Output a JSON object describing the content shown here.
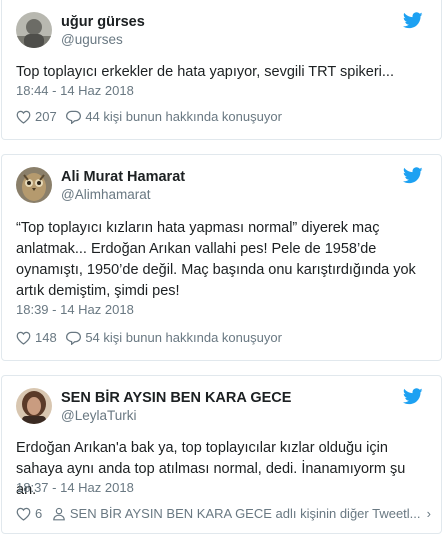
{
  "colors": {
    "twitter_blue": "#1da1f2",
    "meta_gray": "#697882",
    "text": "#1c2022",
    "border": "#e1e8ed"
  },
  "tweets": [
    {
      "display_name": "uğur gürses",
      "screen_name": "@ugurses",
      "avatar_icon": "avatar-photo-gray",
      "text": "Top toplayıcı erkekler de hata yapıyor, sevgili TRT spikeri...",
      "timestamp": "18:44 - 14 Haz 2018",
      "likes": "207",
      "replies_label": "44 kişi bunun hakkında konuşuyor",
      "replies_icon": "speech-bubble-icon"
    },
    {
      "display_name": "Ali Murat Hamarat",
      "screen_name": "@Alimhamarat",
      "avatar_icon": "avatar-photo-owl",
      "text": "“Top toplayıcı kızların hata yapması normal” diyerek maç anlatmak... Erdoğan Arıkan vallahi pes! Pele de 1958’de oynamıştı, 1950’de değil. Maç başında onu karıştırdığında yok artık demiştim, şimdi pes!",
      "timestamp": "18:39 - 14 Haz 2018",
      "likes": "148",
      "replies_label": "54 kişi bunun hakkında konuşuyor",
      "replies_icon": "speech-bubble-icon"
    },
    {
      "display_name": "SEN BİR AYSIN BEN KARA GECE",
      "screen_name": "@LeylaTurki",
      "avatar_icon": "avatar-photo-woman",
      "text": "Erdoğan Arıkan'a bak ya, top toplayıcılar kızlar olduğu için sahaya aynı anda top atılması normal, dedi. İnanamıyorm şu an.",
      "timestamp": "18:37 - 14 Haz 2018",
      "likes": "6",
      "replies_label": "SEN BİR AYSIN BEN KARA GECE adlı kişinin diğer Tweetl...",
      "replies_icon": "person-icon",
      "more_label": "›"
    }
  ]
}
